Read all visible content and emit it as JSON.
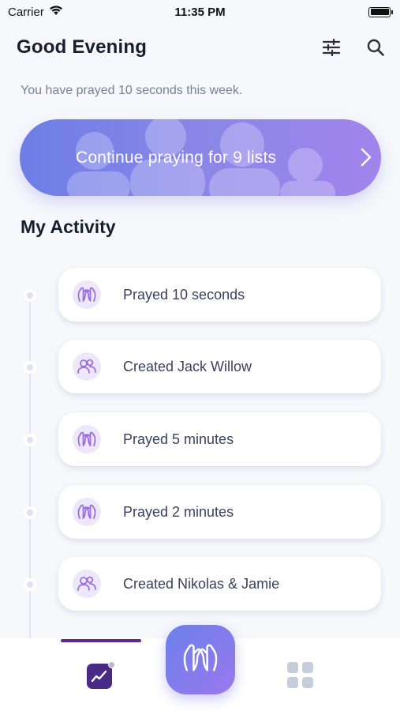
{
  "status_bar": {
    "carrier": "Carrier",
    "time": "11:35 PM"
  },
  "header": {
    "greeting": "Good Evening",
    "filter_icon": "sliders-icon",
    "search_icon": "search-icon"
  },
  "summary": {
    "text": "You have prayed 10 seconds this week."
  },
  "banner": {
    "label": "Continue praying for 9 lists",
    "chevron_icon": "chevron-right-icon"
  },
  "activity": {
    "title": "My Activity",
    "items": [
      {
        "label": "Prayed 10 seconds",
        "icon": "praying-hands-icon"
      },
      {
        "label": "Created Jack Willow",
        "icon": "people-icon"
      },
      {
        "label": "Prayed 5 minutes",
        "icon": "praying-hands-icon"
      },
      {
        "label": "Prayed 2 minutes",
        "icon": "praying-hands-icon"
      },
      {
        "label": "Created Nikolas & Jamie",
        "icon": "people-icon"
      }
    ]
  },
  "tab_bar": {
    "activity_tab_icon": "activity-chart-icon",
    "pray_button_icon": "praying-hands-icon",
    "apps_tab_icon": "grid-icon"
  },
  "colors": {
    "accent_start": "#6d7ee6",
    "accent_end": "#a184ec",
    "tab_active": "#5a2a8c",
    "icon_bg": "#ede7fb",
    "icon_fg": "#9b6be3"
  }
}
